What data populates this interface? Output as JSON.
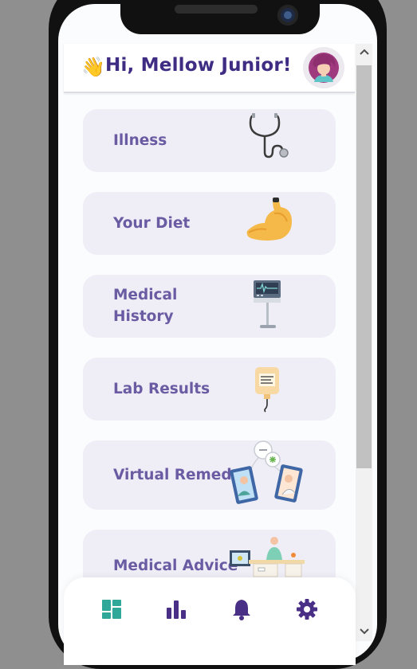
{
  "header": {
    "wave_emoji": "👋",
    "greeting": "Hi, Mellow Junior!"
  },
  "cards": [
    {
      "label": "Illness",
      "icon": "stethoscope-icon"
    },
    {
      "label": "Your Diet",
      "icon": "stomach-icon"
    },
    {
      "label_line1": "Medical",
      "label_line2": "History",
      "icon": "medical-monitor-icon"
    },
    {
      "label": "Lab Results",
      "icon": "iv-bag-icon"
    },
    {
      "label": "Virtual Remedy",
      "icon": "video-consultation-icon"
    },
    {
      "label": "Medical Advice",
      "icon": "doctor-desk-icon"
    }
  ],
  "bottom_nav": [
    {
      "icon": "dashboard-icon",
      "active": true
    },
    {
      "icon": "bar-chart-icon",
      "active": false
    },
    {
      "icon": "bell-icon",
      "active": false
    },
    {
      "icon": "gear-icon",
      "active": false
    }
  ],
  "colors": {
    "brand_purple": "#3f2c83",
    "card_label": "#6a5ba3",
    "card_bg": "#efeef6",
    "active_nav": "#2fa89a"
  }
}
